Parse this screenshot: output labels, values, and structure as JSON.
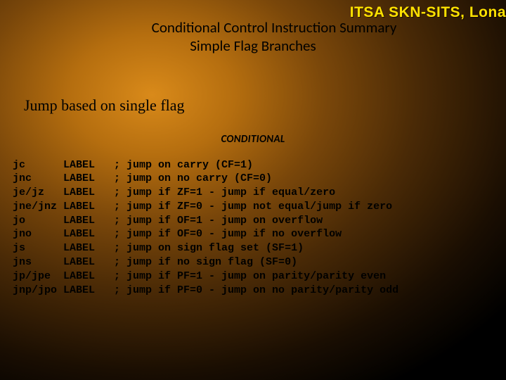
{
  "header": {
    "org": "ITSA SKN-SITS, Lona"
  },
  "title": {
    "line1": "Conditional Control Instruction Summary",
    "line2": "Simple Flag Branches"
  },
  "subheading": "Jump based on single flag",
  "section_label": "CONDITIONAL",
  "code": {
    "mnemonic_width": 8,
    "operand_width": 8,
    "rows": [
      {
        "mnemonic": "jc",
        "operand": "LABEL",
        "comment": "; jump on carry (CF=1)"
      },
      {
        "mnemonic": "jnc",
        "operand": "LABEL",
        "comment": "; jump on no carry (CF=0)"
      },
      {
        "mnemonic": "je/jz",
        "operand": "LABEL",
        "comment": "; jump if ZF=1 - jump if equal/zero"
      },
      {
        "mnemonic": "jne/jnz",
        "operand": "LABEL",
        "comment": "; jump if ZF=0 - jump not equal/jump if zero"
      },
      {
        "mnemonic": "jo",
        "operand": "LABEL",
        "comment": "; jump if OF=1 - jump on overflow"
      },
      {
        "mnemonic": "jno",
        "operand": "LABEL",
        "comment": "; jump if OF=0 - jump if no overflow"
      },
      {
        "mnemonic": "js",
        "operand": "LABEL",
        "comment": "; jump on sign flag set (SF=1)"
      },
      {
        "mnemonic": "jns",
        "operand": "LABEL",
        "comment": "; jump if no sign flag (SF=0)"
      },
      {
        "mnemonic": "jp/jpe",
        "operand": "LABEL",
        "comment": "; jump if PF=1 - jump on parity/parity even"
      },
      {
        "mnemonic": "jnp/jpo",
        "operand": "LABEL",
        "comment": "; jump if PF=0 - jump on no parity/parity odd"
      }
    ]
  }
}
